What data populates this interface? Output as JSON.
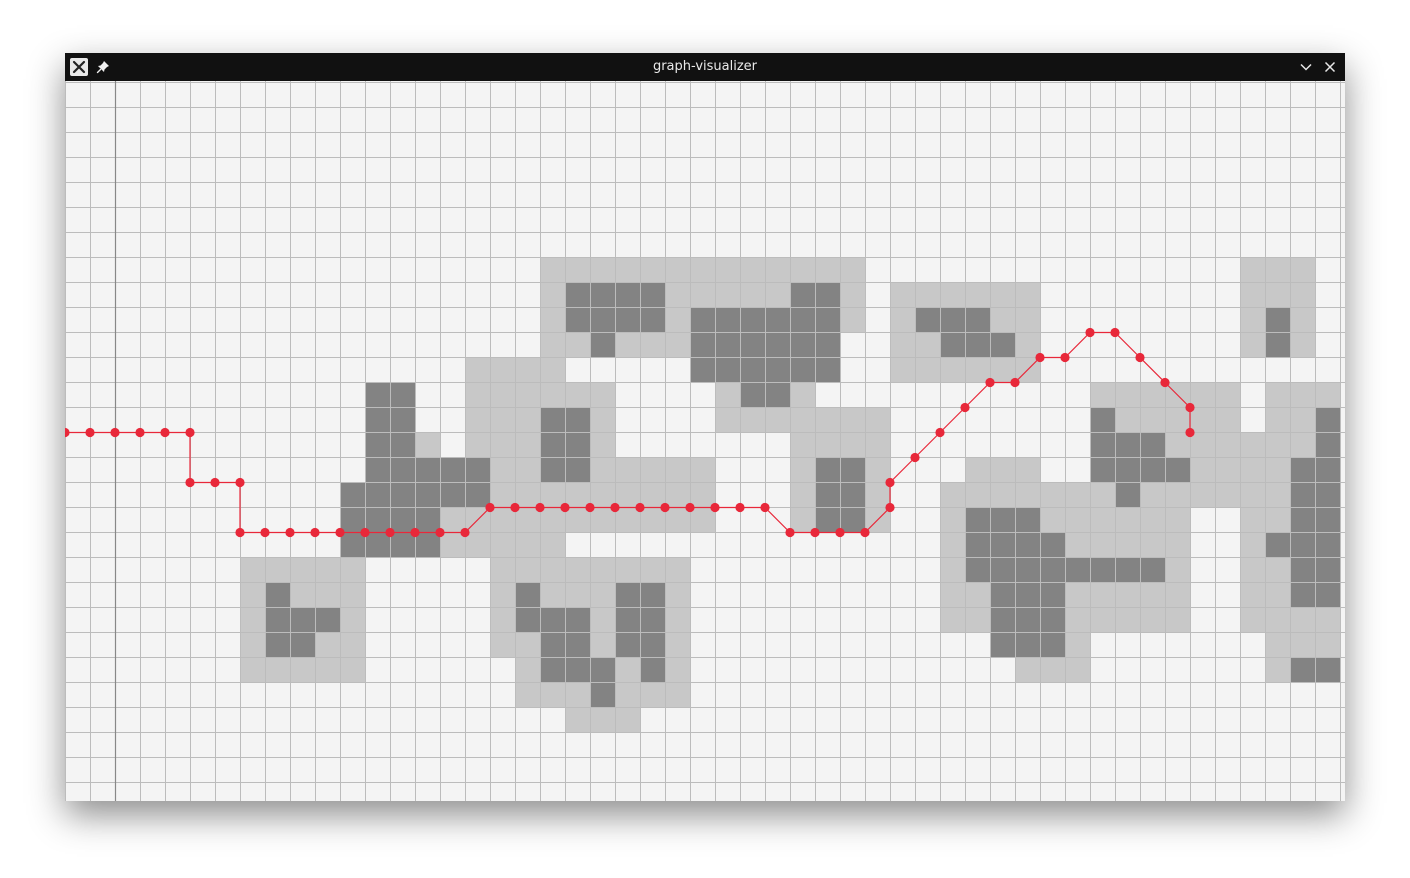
{
  "window": {
    "title": "graph-visualizer",
    "icons": {
      "app": "app-x-icon",
      "pin": "pin-icon",
      "minimize": "chevron-down-icon",
      "close": "close-icon"
    }
  },
  "colors": {
    "canvas_background": "#f4f4f4",
    "grid_line": "#bcbcbc",
    "axis_line": "#888888",
    "obstacle": "#838383",
    "obstacle_margin": "#c8c8c8",
    "path": "#e8283a",
    "titlebar": "#111111"
  },
  "grid": {
    "cell_units": 1,
    "columns": 51,
    "rows": 29,
    "origin_column": 2
  },
  "obstacle_margin_rects": [
    [
      19,
      7,
      6,
      4
    ],
    [
      16,
      11,
      4,
      8
    ],
    [
      13,
      16,
      3,
      3
    ],
    [
      13,
      14,
      2,
      4
    ],
    [
      18,
      13,
      4,
      5
    ],
    [
      20,
      12,
      2,
      2
    ],
    [
      18,
      15,
      8,
      3
    ],
    [
      24,
      7,
      7,
      4
    ],
    [
      28,
      7,
      4,
      3
    ],
    [
      26,
      9,
      4,
      5
    ],
    [
      29,
      13,
      4,
      5
    ],
    [
      33,
      8,
      6,
      4
    ],
    [
      7,
      19,
      5,
      5
    ],
    [
      17,
      19,
      8,
      4
    ],
    [
      18,
      22,
      7,
      3
    ],
    [
      20,
      24,
      3,
      2
    ],
    [
      35,
      16,
      10,
      6
    ],
    [
      36,
      15,
      3,
      3
    ],
    [
      41,
      12,
      6,
      5
    ],
    [
      47,
      7,
      3,
      4
    ],
    [
      47,
      14,
      4,
      8
    ],
    [
      48,
      12,
      3,
      12
    ],
    [
      35,
      19,
      2,
      3
    ],
    [
      38,
      21,
      3,
      3
    ]
  ],
  "obstacle_core_rects": [
    [
      20,
      8,
      4,
      2
    ],
    [
      21,
      10,
      1,
      1
    ],
    [
      25,
      9,
      6,
      3
    ],
    [
      29,
      8,
      2,
      2
    ],
    [
      25,
      10,
      1,
      2
    ],
    [
      27,
      12,
      2,
      1
    ],
    [
      12,
      12,
      2,
      6
    ],
    [
      14,
      15,
      3,
      2
    ],
    [
      11,
      16,
      2,
      3
    ],
    [
      12,
      17,
      3,
      2
    ],
    [
      19,
      13,
      2,
      3
    ],
    [
      30,
      15,
      2,
      3
    ],
    [
      31,
      17,
      1,
      1
    ],
    [
      34,
      9,
      3,
      1
    ],
    [
      35,
      10,
      3,
      1
    ],
    [
      8,
      20,
      1,
      3
    ],
    [
      9,
      21,
      2,
      1
    ],
    [
      8,
      22,
      2,
      1
    ],
    [
      18,
      20,
      1,
      2
    ],
    [
      19,
      21,
      2,
      3
    ],
    [
      22,
      20,
      2,
      3
    ],
    [
      23,
      22,
      1,
      2
    ],
    [
      21,
      23,
      1,
      2
    ],
    [
      36,
      17,
      2,
      3
    ],
    [
      38,
      17,
      1,
      3
    ],
    [
      37,
      18,
      3,
      5
    ],
    [
      39,
      19,
      5,
      1
    ],
    [
      38,
      20,
      1,
      2
    ],
    [
      41,
      13,
      1,
      3
    ],
    [
      42,
      14,
      2,
      2
    ],
    [
      44,
      15,
      1,
      1
    ],
    [
      42,
      16,
      1,
      1
    ],
    [
      48,
      9,
      1,
      2
    ],
    [
      49,
      15,
      2,
      6
    ],
    [
      48,
      18,
      2,
      1
    ],
    [
      50,
      13,
      1,
      3
    ],
    [
      49,
      23,
      2,
      1
    ]
  ],
  "path_nodes": [
    [
      0,
      14
    ],
    [
      1,
      14
    ],
    [
      2,
      14
    ],
    [
      3,
      14
    ],
    [
      4,
      14
    ],
    [
      5,
      14
    ],
    [
      5,
      16
    ],
    [
      6,
      16
    ],
    [
      7,
      16
    ],
    [
      7,
      18
    ],
    [
      8,
      18
    ],
    [
      9,
      18
    ],
    [
      10,
      18
    ],
    [
      11,
      18
    ],
    [
      12,
      18
    ],
    [
      13,
      18
    ],
    [
      14,
      18
    ],
    [
      15,
      18
    ],
    [
      16,
      18
    ],
    [
      17,
      17
    ],
    [
      18,
      17
    ],
    [
      19,
      17
    ],
    [
      20,
      17
    ],
    [
      21,
      17
    ],
    [
      22,
      17
    ],
    [
      23,
      17
    ],
    [
      24,
      17
    ],
    [
      25,
      17
    ],
    [
      26,
      17
    ],
    [
      27,
      17
    ],
    [
      28,
      17
    ],
    [
      29,
      18
    ],
    [
      30,
      18
    ],
    [
      31,
      18
    ],
    [
      32,
      18
    ],
    [
      33,
      17
    ],
    [
      33,
      16
    ],
    [
      34,
      15
    ],
    [
      35,
      14
    ],
    [
      36,
      13
    ],
    [
      37,
      12
    ],
    [
      38,
      12
    ],
    [
      39,
      11
    ],
    [
      40,
      11
    ],
    [
      41,
      10
    ],
    [
      42,
      10
    ],
    [
      43,
      11
    ],
    [
      44,
      12
    ],
    [
      45,
      13
    ],
    [
      45,
      14
    ]
  ]
}
